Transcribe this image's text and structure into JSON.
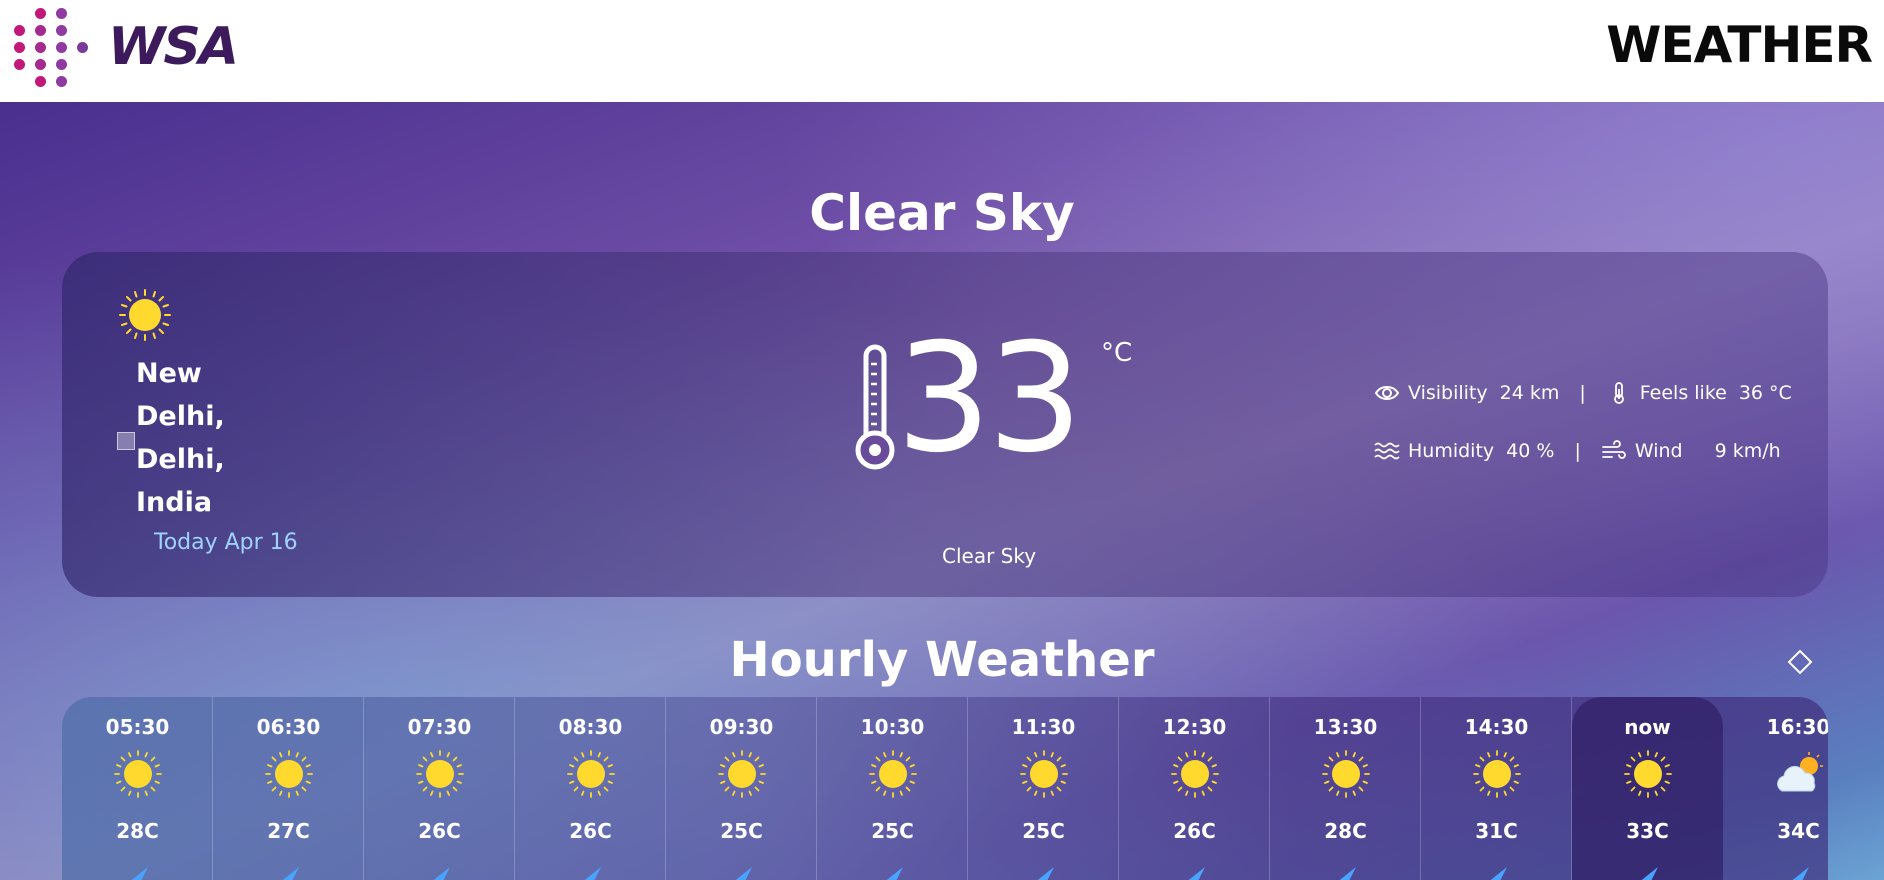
{
  "header": {
    "brand": "WSA",
    "title": "WEATHER",
    "logo_colors": [
      "#c2187a",
      "#8e3aa0",
      "#5a2d82"
    ]
  },
  "current": {
    "condition_title": "Clear Sky",
    "location": [
      "New",
      "Delhi,",
      "Delhi,",
      "India"
    ],
    "date": "Today Apr 16",
    "temperature": "33",
    "unit": "°C",
    "condition": "Clear Sky",
    "icon": "sun-icon",
    "stats": {
      "visibility_label": "Visibility",
      "visibility_value": "24 km",
      "feels_like_label": "Feels like",
      "feels_like_value": "36 °C",
      "humidity_label": "Humidity",
      "humidity_value": "40 %",
      "wind_label": "Wind",
      "wind_value": "9 km/h",
      "separator": "|"
    }
  },
  "hourly": {
    "title": "Hourly Weather",
    "slots": [
      {
        "time": "05:30",
        "temp": "28C",
        "icon": "sun-icon",
        "active": false
      },
      {
        "time": "06:30",
        "temp": "27C",
        "icon": "sun-icon",
        "active": false
      },
      {
        "time": "07:30",
        "temp": "26C",
        "icon": "sun-icon",
        "active": false
      },
      {
        "time": "08:30",
        "temp": "26C",
        "icon": "sun-icon",
        "active": false
      },
      {
        "time": "09:30",
        "temp": "25C",
        "icon": "sun-icon",
        "active": false
      },
      {
        "time": "10:30",
        "temp": "25C",
        "icon": "sun-icon",
        "active": false
      },
      {
        "time": "11:30",
        "temp": "25C",
        "icon": "sun-icon",
        "active": false
      },
      {
        "time": "12:30",
        "temp": "26C",
        "icon": "sun-icon",
        "active": false
      },
      {
        "time": "13:30",
        "temp": "28C",
        "icon": "sun-icon",
        "active": false
      },
      {
        "time": "14:30",
        "temp": "31C",
        "icon": "sun-icon",
        "active": false
      },
      {
        "time": "now",
        "temp": "33C",
        "icon": "sun-icon",
        "active": true
      },
      {
        "time": "16:30",
        "temp": "34C",
        "icon": "partly-cloudy-icon",
        "active": false
      }
    ]
  }
}
